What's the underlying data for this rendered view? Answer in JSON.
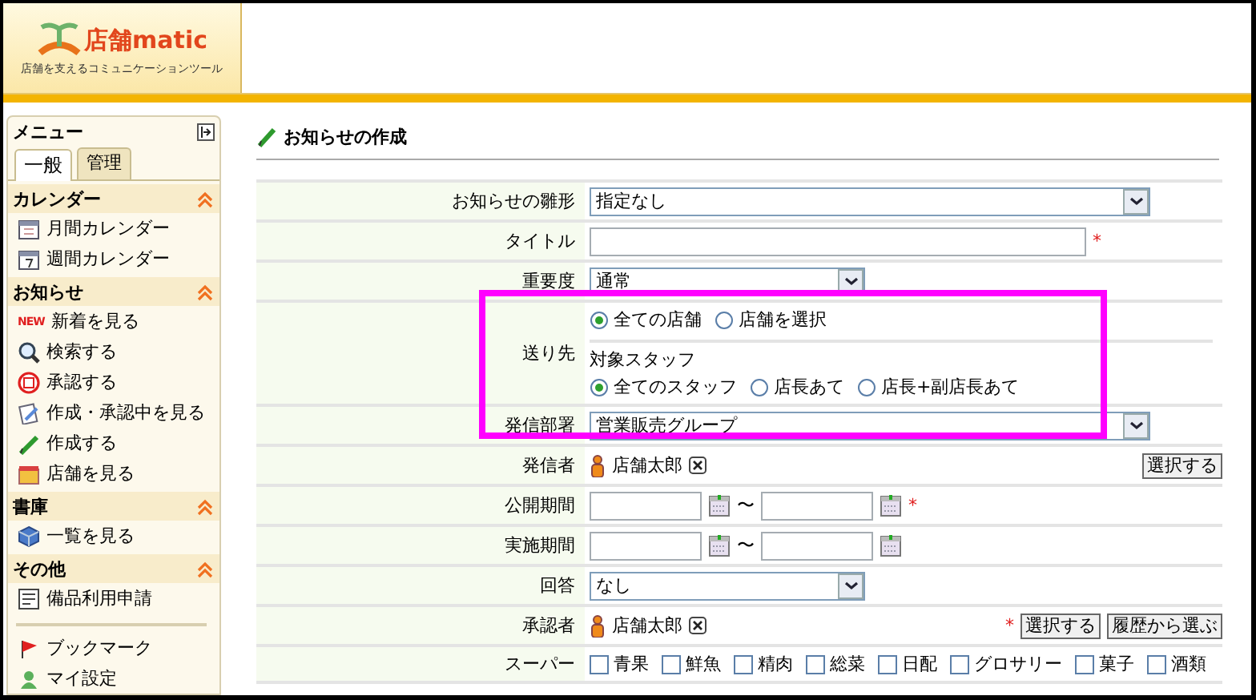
{
  "header": {
    "logo_text": "店舗matic",
    "tagline": "店舗を支えるコミュニケーションツール"
  },
  "sidebar": {
    "title": "メニュー",
    "tabs": [
      {
        "label": "一般",
        "selected": true
      },
      {
        "label": "管理",
        "selected": false
      }
    ],
    "sections": [
      {
        "title": "カレンダー",
        "expanded": true,
        "items": [
          {
            "label": "月間カレンダー"
          },
          {
            "label": "週間カレンダー"
          }
        ]
      },
      {
        "title": "お知らせ",
        "expanded": true,
        "items": [
          {
            "label": "新着を見る",
            "badge": "NEW"
          },
          {
            "label": "検索する"
          },
          {
            "label": "承認する"
          },
          {
            "label": "作成・承認中を見る"
          },
          {
            "label": "作成する"
          },
          {
            "label": "店舗を見る"
          }
        ]
      },
      {
        "title": "書庫",
        "expanded": true,
        "items": [
          {
            "label": "一覧を見る"
          }
        ]
      },
      {
        "title": "その他",
        "expanded": true,
        "items": [
          {
            "label": "備品利用申請"
          }
        ]
      }
    ],
    "extra_items": [
      {
        "label": "ブックマーク"
      },
      {
        "label": "マイ設定"
      }
    ]
  },
  "page": {
    "title": "お知らせの作成",
    "required_mark": "*",
    "rows": [
      {
        "label": "お知らせの雛形",
        "kind": "wide-select",
        "value": "指定なし"
      },
      {
        "label": "タイトル",
        "kind": "text",
        "required": true
      },
      {
        "label": "重要度",
        "kind": "short-select",
        "value": "通常"
      },
      {
        "label": "送り先",
        "kind": "recipients",
        "radios": [
          {
            "label": "全ての店舗",
            "selected": true
          },
          {
            "label": "店舗を選択",
            "selected": false
          }
        ],
        "staff_label": "対象スタッフ",
        "staff_radios": [
          {
            "label": "全てのスタッフ",
            "selected": true
          },
          {
            "label": "店長あて",
            "selected": false
          },
          {
            "label": "店長+副店長あて",
            "selected": false
          }
        ]
      },
      {
        "label": "発信部署",
        "kind": "wide-select",
        "value": "営業販売グループ"
      },
      {
        "label": "発信者",
        "kind": "person",
        "person": "店舗太郎",
        "required": false,
        "buttons": [
          "選択する"
        ]
      },
      {
        "label": "公開期間",
        "kind": "date-range",
        "separator": "〜",
        "required": true
      },
      {
        "label": "実施期間",
        "kind": "date-range",
        "separator": "〜",
        "required": false
      },
      {
        "label": "回答",
        "kind": "short-select",
        "value": "なし"
      },
      {
        "label": "承認者",
        "kind": "person",
        "person": "店舗太郎",
        "required": true,
        "buttons": [
          "選択する",
          "履歴から選ぶ"
        ]
      },
      {
        "label": "スーパー",
        "kind": "checkboxes",
        "options": [
          {
            "label": "青果",
            "checked": false
          },
          {
            "label": "鮮魚",
            "checked": false
          },
          {
            "label": "精肉",
            "checked": false
          },
          {
            "label": "総菜",
            "checked": false
          },
          {
            "label": "日配",
            "checked": false
          },
          {
            "label": "グロサリー",
            "checked": false
          },
          {
            "label": "菓子",
            "checked": false
          },
          {
            "label": "酒類",
            "checked": false
          }
        ]
      }
    ],
    "highlight": {
      "kind": "box",
      "color": "#ff00ff"
    }
  }
}
